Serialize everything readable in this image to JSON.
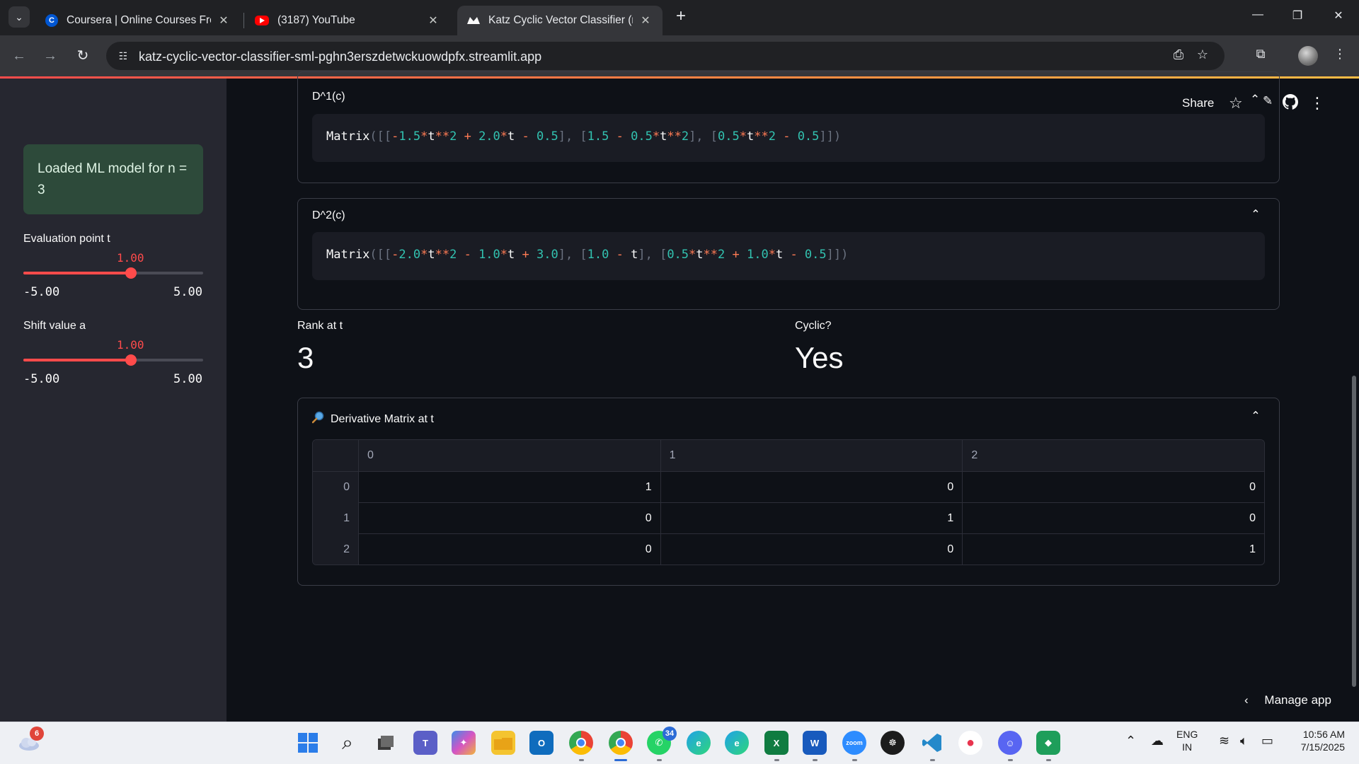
{
  "browser": {
    "tabs": [
      {
        "title": "Coursera | Online Courses From",
        "favicon": "coursera-icon",
        "favicon_char": "C",
        "active": false
      },
      {
        "title": "(3187) YouTube",
        "favicon": "youtube-icon",
        "active": false
      },
      {
        "title": "Katz Cyclic Vector Classifier (n=",
        "favicon": "streamlit-icon",
        "active": true
      }
    ],
    "url": "katz-cyclic-vector-classifier-sml-pghn3erszdetwckuowdpfx.streamlit.app"
  },
  "sidebar": {
    "model_message": "Loaded ML model for n = 3",
    "sliders": [
      {
        "label": "Evaluation point t",
        "value": "1.00",
        "min": "-5.00",
        "max": "5.00",
        "fraction": 0.6
      },
      {
        "label": "Shift value a",
        "value": "1.00",
        "min": "-5.00",
        "max": "5.00",
        "fraction": 0.6
      }
    ]
  },
  "header": {
    "share_label": "Share"
  },
  "expanders": [
    {
      "title": "D^1(c)",
      "code_tokens": [
        [
          "fn",
          "Matrix"
        ],
        [
          "p",
          "([["
        ],
        [
          "op",
          "-"
        ],
        [
          "num",
          "1.5"
        ],
        [
          "op",
          "*"
        ],
        [
          "var",
          "t"
        ],
        [
          "op",
          "**"
        ],
        [
          "num",
          "2"
        ],
        [
          "op",
          " + "
        ],
        [
          "num",
          "2.0"
        ],
        [
          "op",
          "*"
        ],
        [
          "var",
          "t"
        ],
        [
          "op",
          " - "
        ],
        [
          "num",
          "0.5"
        ],
        [
          "p",
          "], ["
        ],
        [
          "num",
          "1.5"
        ],
        [
          "op",
          " - "
        ],
        [
          "num",
          "0.5"
        ],
        [
          "op",
          "*"
        ],
        [
          "var",
          "t"
        ],
        [
          "op",
          "**"
        ],
        [
          "num",
          "2"
        ],
        [
          "p",
          "], ["
        ],
        [
          "num",
          "0.5"
        ],
        [
          "op",
          "*"
        ],
        [
          "var",
          "t"
        ],
        [
          "op",
          "**"
        ],
        [
          "num",
          "2"
        ],
        [
          "op",
          " - "
        ],
        [
          "num",
          "0.5"
        ],
        [
          "p",
          "]])"
        ]
      ]
    },
    {
      "title": "D^2(c)",
      "code_tokens": [
        [
          "fn",
          "Matrix"
        ],
        [
          "p",
          "([["
        ],
        [
          "op",
          "-"
        ],
        [
          "num",
          "2.0"
        ],
        [
          "op",
          "*"
        ],
        [
          "var",
          "t"
        ],
        [
          "op",
          "**"
        ],
        [
          "num",
          "2"
        ],
        [
          "op",
          " - "
        ],
        [
          "num",
          "1.0"
        ],
        [
          "op",
          "*"
        ],
        [
          "var",
          "t"
        ],
        [
          "op",
          " + "
        ],
        [
          "num",
          "3.0"
        ],
        [
          "p",
          "], ["
        ],
        [
          "num",
          "1.0"
        ],
        [
          "op",
          " - "
        ],
        [
          "var",
          "t"
        ],
        [
          "p",
          "], ["
        ],
        [
          "num",
          "0.5"
        ],
        [
          "op",
          "*"
        ],
        [
          "var",
          "t"
        ],
        [
          "op",
          "**"
        ],
        [
          "num",
          "2"
        ],
        [
          "op",
          " + "
        ],
        [
          "num",
          "1.0"
        ],
        [
          "op",
          "*"
        ],
        [
          "var",
          "t"
        ],
        [
          "op",
          " - "
        ],
        [
          "num",
          "0.5"
        ],
        [
          "p",
          "]])"
        ]
      ]
    }
  ],
  "metrics": [
    {
      "label": "Rank at t",
      "value": "3"
    },
    {
      "label": "Cyclic?",
      "value": "Yes"
    }
  ],
  "derivative_matrix": {
    "title": "Derivative Matrix at t",
    "columns": [
      "0",
      "1",
      "2"
    ],
    "rows": [
      {
        "index": "0",
        "values": [
          "1",
          "0",
          "0"
        ]
      },
      {
        "index": "1",
        "values": [
          "0",
          "1",
          "0"
        ]
      },
      {
        "index": "2",
        "values": [
          "0",
          "0",
          "1"
        ]
      }
    ]
  },
  "manage_app_label": "Manage app",
  "taskbar": {
    "weather_badge": "6",
    "whatsapp_badge": "34",
    "language": "ENG",
    "region": "IN",
    "time": "10:56 AM",
    "date": "7/15/2025"
  },
  "colors": {
    "accent": "#ff4b4b",
    "success_bg": "#2d4a3a",
    "code_number": "#32c2b0",
    "code_operator": "#ff7b54"
  }
}
